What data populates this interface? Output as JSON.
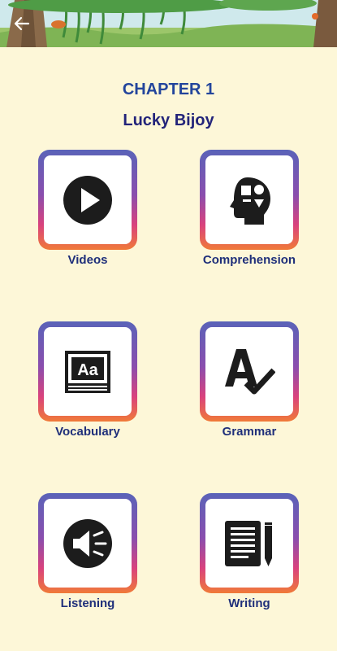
{
  "header": {
    "chapter": "CHAPTER 1",
    "book_title": "Lucky Bijoy"
  },
  "menu": [
    {
      "label": "Videos",
      "icon": "play-circle-icon"
    },
    {
      "label": "Comprehension",
      "icon": "head-shapes-icon"
    },
    {
      "label": "Vocabulary",
      "icon": "dictionary-book-icon"
    },
    {
      "label": "Grammar",
      "icon": "grammar-check-icon"
    },
    {
      "label": "Listening",
      "icon": "speaker-icon"
    },
    {
      "label": "Writing",
      "icon": "notepad-pencil-icon"
    }
  ],
  "colors": {
    "background": "#fdf7d8",
    "title": "#23459c",
    "label": "#1f2f7a",
    "tile_gradient": [
      "#5a63b8",
      "#8a4eae",
      "#d9427d",
      "#f07a38"
    ]
  }
}
